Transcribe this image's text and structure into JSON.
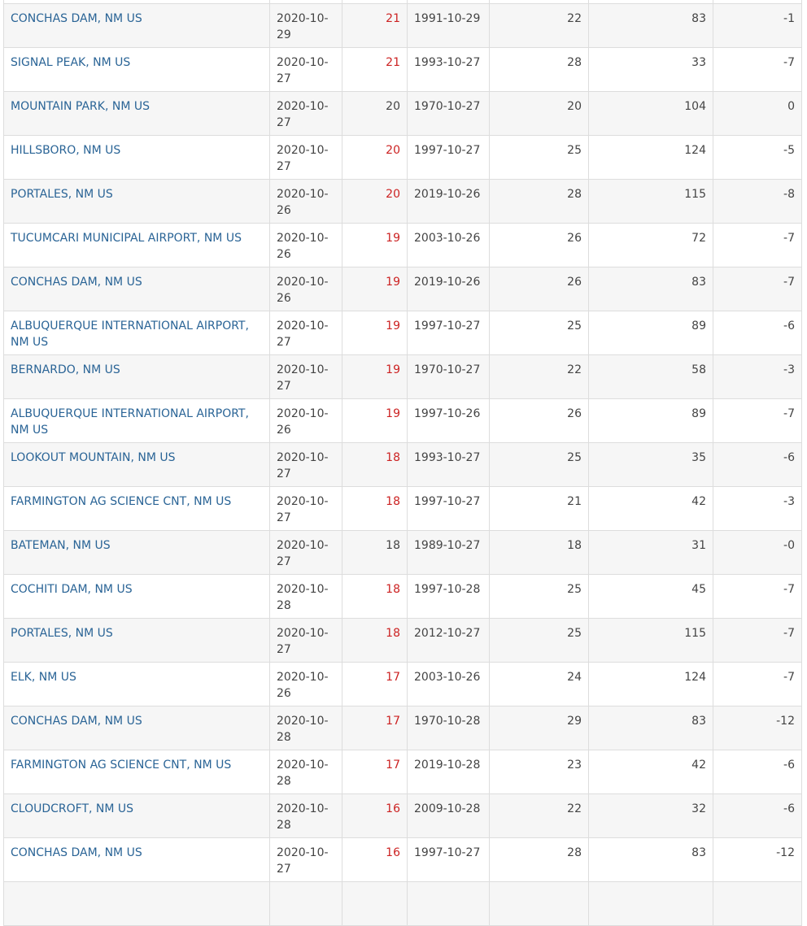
{
  "colors": {
    "link": "#2a6496",
    "record_value": "#cc2222",
    "text": "#444444",
    "border": "#dddddd",
    "row_stripe": "#f6f6f6"
  },
  "rows": [
    {
      "station": "",
      "date": "",
      "value": "",
      "prev_date": "",
      "prev_value": "",
      "years": "",
      "diff": ""
    },
    {
      "station": "CONCHAS DAM, NM US",
      "date": "2020-10-29",
      "value": "21",
      "record": true,
      "prev_date": "1991-10-29",
      "prev_value": "22",
      "years": "83",
      "diff": "-1"
    },
    {
      "station": "SIGNAL PEAK, NM US",
      "date": "2020-10-27",
      "value": "21",
      "record": true,
      "prev_date": "1993-10-27",
      "prev_value": "28",
      "years": "33",
      "diff": "-7"
    },
    {
      "station": "MOUNTAIN PARK, NM US",
      "date": "2020-10-27",
      "value": "20",
      "record": false,
      "prev_date": "1970-10-27",
      "prev_value": "20",
      "years": "104",
      "diff": "0"
    },
    {
      "station": "HILLSBORO, NM US",
      "date": "2020-10-27",
      "value": "20",
      "record": true,
      "prev_date": "1997-10-27",
      "prev_value": "25",
      "years": "124",
      "diff": "-5"
    },
    {
      "station": "PORTALES, NM US",
      "date": "2020-10-26",
      "value": "20",
      "record": true,
      "prev_date": "2019-10-26",
      "prev_value": "28",
      "years": "115",
      "diff": "-8"
    },
    {
      "station": "TUCUMCARI MUNICIPAL AIRPORT, NM US",
      "date": "2020-10-26",
      "value": "19",
      "record": true,
      "prev_date": "2003-10-26",
      "prev_value": "26",
      "years": "72",
      "diff": "-7"
    },
    {
      "station": "CONCHAS DAM, NM US",
      "date": "2020-10-26",
      "value": "19",
      "record": true,
      "prev_date": "2019-10-26",
      "prev_value": "26",
      "years": "83",
      "diff": "-7"
    },
    {
      "station": "ALBUQUERQUE INTERNATIONAL AIRPORT, NM US",
      "date": "2020-10-27",
      "value": "19",
      "record": true,
      "prev_date": "1997-10-27",
      "prev_value": "25",
      "years": "89",
      "diff": "-6"
    },
    {
      "station": "BERNARDO, NM US",
      "date": "2020-10-27",
      "value": "19",
      "record": true,
      "prev_date": "1970-10-27",
      "prev_value": "22",
      "years": "58",
      "diff": "-3"
    },
    {
      "station": "ALBUQUERQUE INTERNATIONAL AIRPORT, NM US",
      "date": "2020-10-26",
      "value": "19",
      "record": true,
      "prev_date": "1997-10-26",
      "prev_value": "26",
      "years": "89",
      "diff": "-7"
    },
    {
      "station": "LOOKOUT MOUNTAIN, NM US",
      "date": "2020-10-27",
      "value": "18",
      "record": true,
      "prev_date": "1993-10-27",
      "prev_value": "25",
      "years": "35",
      "diff": "-6"
    },
    {
      "station": "FARMINGTON AG SCIENCE CNT, NM US",
      "date": "2020-10-27",
      "value": "18",
      "record": true,
      "prev_date": "1997-10-27",
      "prev_value": "21",
      "years": "42",
      "diff": "-3"
    },
    {
      "station": "BATEMAN, NM US",
      "date": "2020-10-27",
      "value": "18",
      "record": false,
      "prev_date": "1989-10-27",
      "prev_value": "18",
      "years": "31",
      "diff": "-0"
    },
    {
      "station": "COCHITI DAM, NM US",
      "date": "2020-10-28",
      "value": "18",
      "record": true,
      "prev_date": "1997-10-28",
      "prev_value": "25",
      "years": "45",
      "diff": "-7"
    },
    {
      "station": "PORTALES, NM US",
      "date": "2020-10-27",
      "value": "18",
      "record": true,
      "prev_date": "2012-10-27",
      "prev_value": "25",
      "years": "115",
      "diff": "-7"
    },
    {
      "station": "ELK, NM US",
      "date": "2020-10-26",
      "value": "17",
      "record": true,
      "prev_date": "2003-10-26",
      "prev_value": "24",
      "years": "124",
      "diff": "-7"
    },
    {
      "station": "CONCHAS DAM, NM US",
      "date": "2020-10-28",
      "value": "17",
      "record": true,
      "prev_date": "1970-10-28",
      "prev_value": "29",
      "years": "83",
      "diff": "-12"
    },
    {
      "station": "FARMINGTON AG SCIENCE CNT, NM US",
      "date": "2020-10-28",
      "value": "17",
      "record": true,
      "prev_date": "2019-10-28",
      "prev_value": "23",
      "years": "42",
      "diff": "-6"
    },
    {
      "station": "CLOUDCROFT, NM US",
      "date": "2020-10-28",
      "value": "16",
      "record": true,
      "prev_date": "2009-10-28",
      "prev_value": "22",
      "years": "32",
      "diff": "-6"
    },
    {
      "station": "CONCHAS DAM, NM US",
      "date": "2020-10-27",
      "value": "16",
      "record": true,
      "prev_date": "1997-10-27",
      "prev_value": "28",
      "years": "83",
      "diff": "-12"
    },
    {
      "station": "",
      "date": "",
      "value": "",
      "prev_date": "",
      "prev_value": "",
      "years": "",
      "diff": ""
    }
  ]
}
